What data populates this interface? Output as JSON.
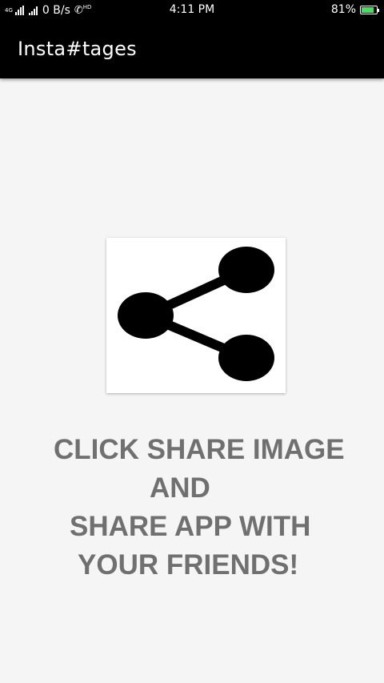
{
  "status_bar": {
    "network_type_top": "4G",
    "network_type_bottom": "HD",
    "speed": "0 B/s",
    "time": "4:11 PM",
    "battery_percent": "81%",
    "battery_level": 0.81,
    "battery_color": "#4cd964"
  },
  "app_bar": {
    "title": "Insta#tages"
  },
  "share": {
    "icon": "share-icon"
  },
  "message": {
    "line1": "CLICK SHARE IMAGE",
    "line2": "AND",
    "line3": "SHARE APP WITH",
    "line4": "YOUR FRIENDS!"
  },
  "colors": {
    "background": "#f5f5f5",
    "app_bar": "#000000",
    "message_text": "#707070"
  }
}
